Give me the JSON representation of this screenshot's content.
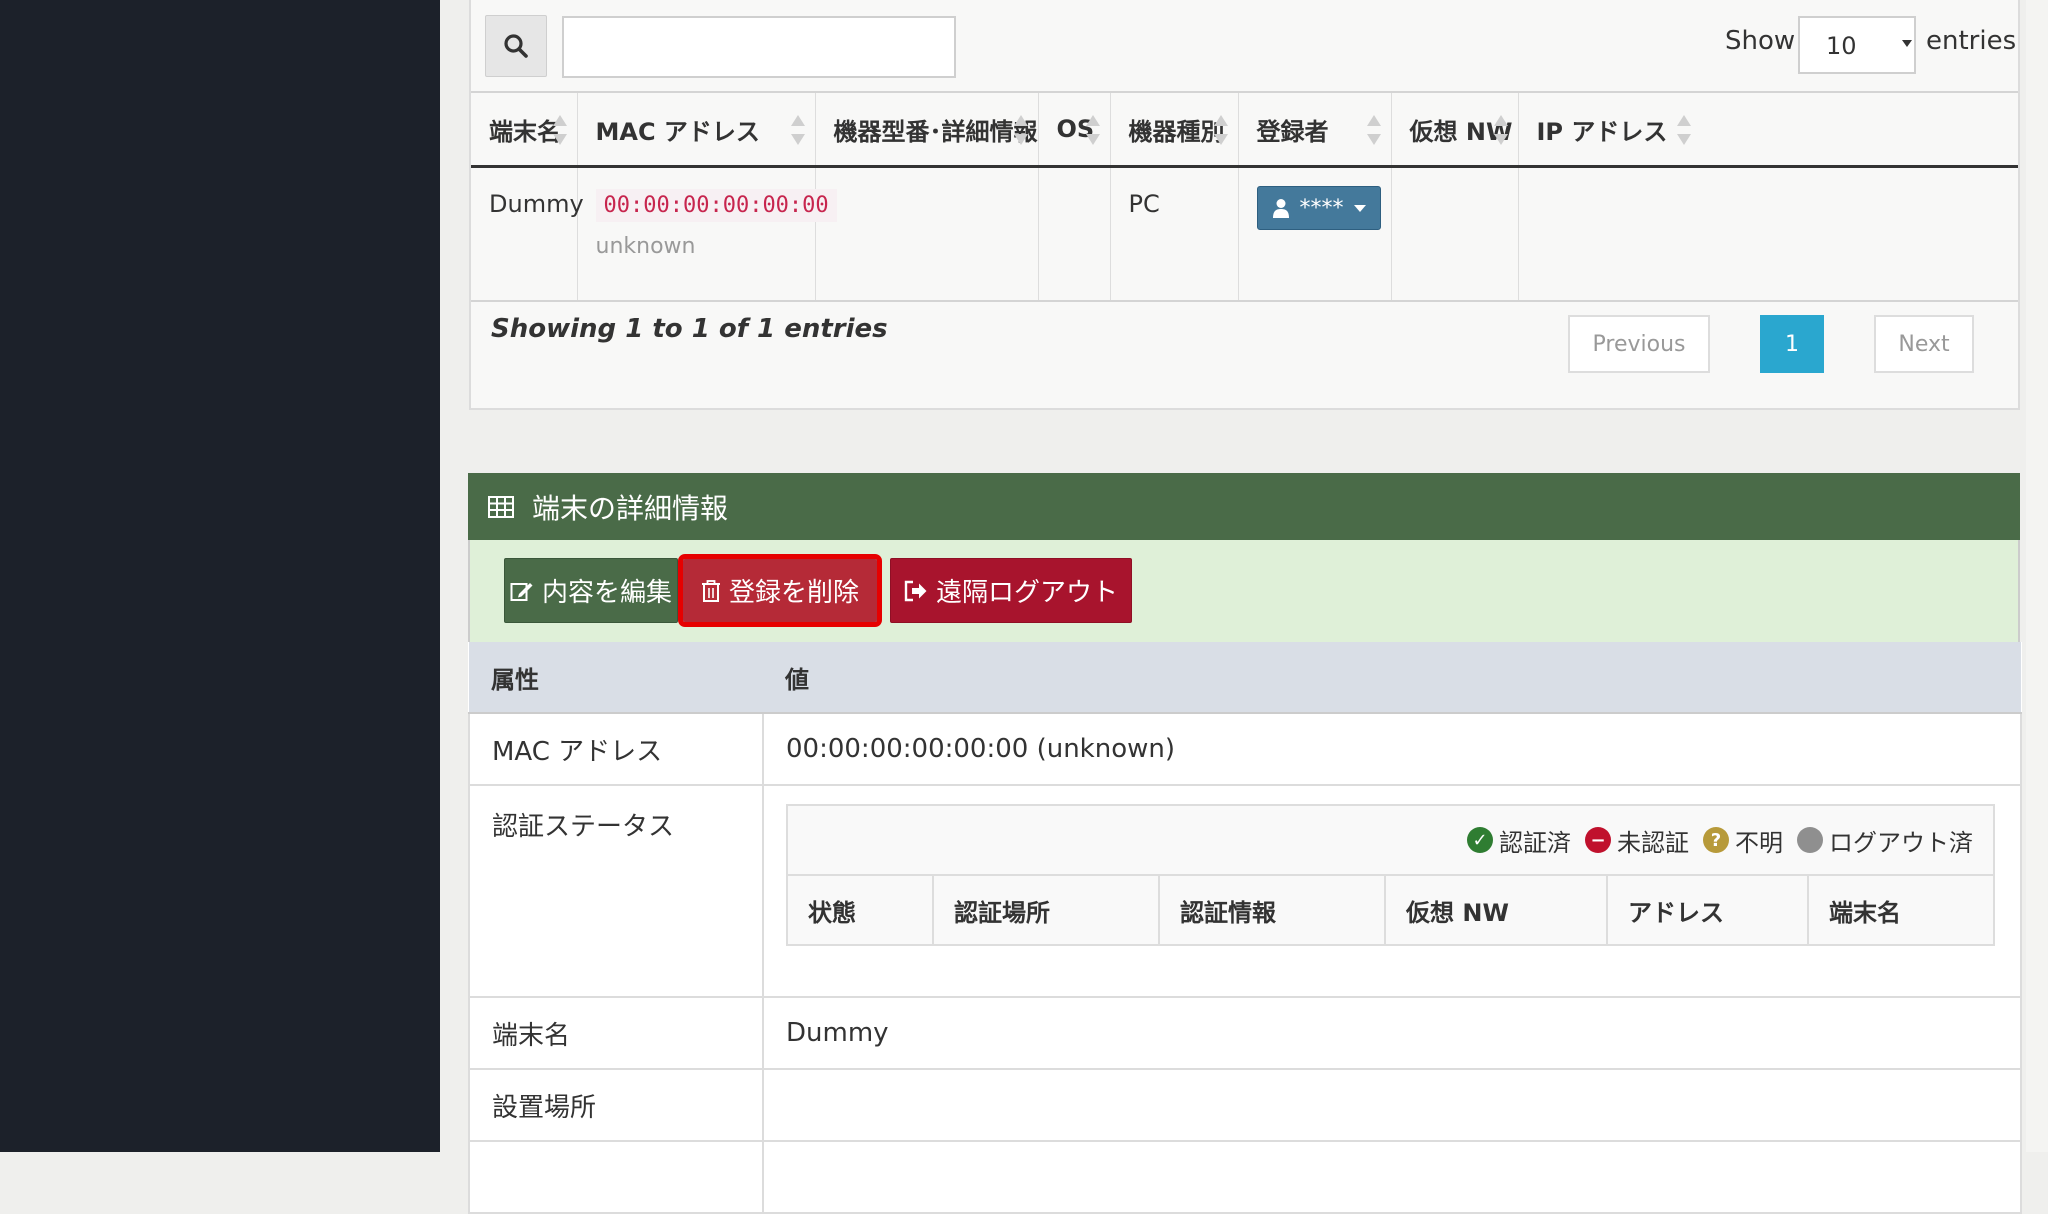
{
  "list": {
    "show_label": "Show",
    "entries_value": "10",
    "entries_label": "entries",
    "columns": [
      "端末名",
      "MAC アドレス",
      "機器型番･詳細情報",
      "OS",
      "機器種別",
      "登録者",
      "仮想 NW",
      "IP アドレス"
    ],
    "row": {
      "name": "Dummy",
      "mac": "00:00:00:00:00:00",
      "mac_vendor": "unknown",
      "model": "",
      "os": "",
      "type": "PC",
      "registrant": "****",
      "vnw": "",
      "ip": ""
    },
    "info": "Showing 1 to 1 of 1 entries",
    "pagination": {
      "previous": "Previous",
      "current": "1",
      "next": "Next"
    }
  },
  "detail": {
    "title": "端末の詳細情報",
    "buttons": {
      "edit": "内容を編集",
      "delete": "登録を削除",
      "logout": "遠隔ログアウト"
    },
    "header": {
      "attribute": "属性",
      "value": "値"
    },
    "rows": {
      "mac_label": "MAC アドレス",
      "mac_value": "00:00:00:00:00:00 (unknown)",
      "auth_label": "認証ステータス",
      "name_label": "端末名",
      "name_value": "Dummy",
      "location_label": "設置場所",
      "location_value": ""
    },
    "legend": {
      "authed": "認証済",
      "unauthed": "未認証",
      "unknown": "不明",
      "logged_out": "ログアウト済"
    },
    "status_columns": [
      "状態",
      "認証場所",
      "認証情報",
      "仮想 NW",
      "アドレス",
      "端末名"
    ]
  },
  "colors": {
    "sidebar": "#1c212a",
    "panel_header": "#4a6b48",
    "pager_active": "#2aa7cf",
    "danger": "#a8142d",
    "highlight": "#e60000"
  }
}
